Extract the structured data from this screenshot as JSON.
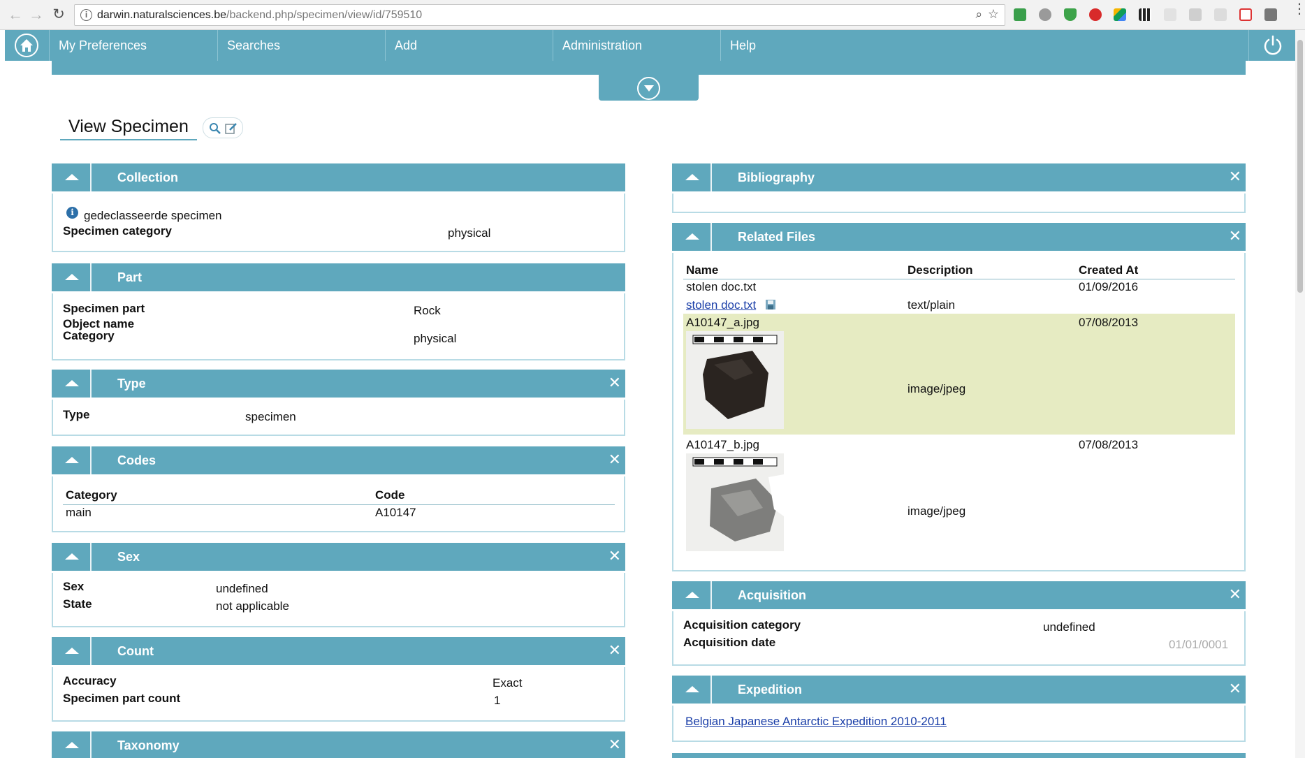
{
  "browser": {
    "url_host": "darwin.naturalsciences.be",
    "url_path": "/backend.php/specimen/view/id/759510"
  },
  "nav": {
    "items": [
      "My Preferences",
      "Searches",
      "Add",
      "Administration",
      "Help"
    ]
  },
  "page": {
    "title": "View Specimen"
  },
  "widgets": {
    "collection": {
      "title": "Collection",
      "collection_name": "gedeclasseerde specimen",
      "category_label": "Specimen category",
      "category_value": "physical"
    },
    "part": {
      "title": "Part",
      "labels": [
        "Specimen part",
        "Object name",
        "Category"
      ],
      "specimen_part": "Rock",
      "category": "physical"
    },
    "type": {
      "title": "Type",
      "label": "Type",
      "value": "specimen"
    },
    "codes": {
      "title": "Codes",
      "headers": [
        "Category",
        "Code"
      ],
      "rows": [
        [
          "main",
          "A10147"
        ]
      ]
    },
    "sex": {
      "title": "Sex",
      "sex_label": "Sex",
      "sex_value": "undefined",
      "state_label": "State",
      "state_value": "not applicable"
    },
    "count": {
      "title": "Count",
      "accuracy_label": "Accuracy",
      "accuracy_value": "Exact",
      "part_count_label": "Specimen part count",
      "part_count_value": "1"
    },
    "taxonomy": {
      "title": "Taxonomy"
    },
    "bibliography": {
      "title": "Bibliography"
    },
    "related_files": {
      "title": "Related Files",
      "headers": [
        "Name",
        "Description",
        "Created At"
      ],
      "files": [
        {
          "name": "stolen doc.txt",
          "link": "stolen doc.txt",
          "description": "text/plain",
          "created": "01/09/2016"
        },
        {
          "name": "A10147_a.jpg",
          "description": "image/jpeg",
          "created": "07/08/2013"
        },
        {
          "name": "A10147_b.jpg",
          "description": "image/jpeg",
          "created": "07/08/2013"
        }
      ]
    },
    "acquisition": {
      "title": "Acquisition",
      "category_label": "Acquisition category",
      "category_value": "undefined",
      "date_label": "Acquisition date",
      "date_value": "01/01/0001"
    },
    "expedition": {
      "title": "Expedition",
      "link": "Belgian Japanese Antarctic Expedition 2010-2011"
    }
  },
  "icons": {
    "home": "home-icon",
    "power": "power-icon",
    "expand": "chevron-down-circle-icon",
    "collapse": "triangle-up-icon",
    "close": "close-icon",
    "info": "info-icon",
    "search_record": "search-icon",
    "edit_record": "edit-icon",
    "download": "save-icon"
  },
  "colors": {
    "accent": "#5fa8bd",
    "highlight_row": "#e6ebc2",
    "link": "#1a3ea8"
  }
}
